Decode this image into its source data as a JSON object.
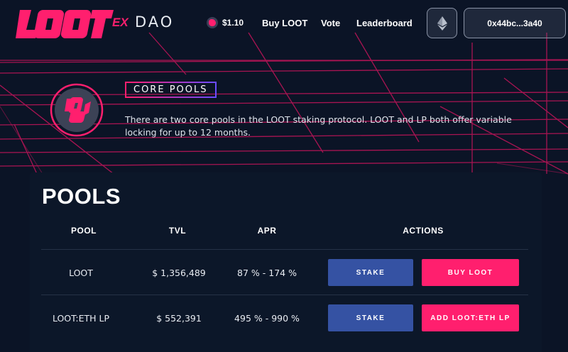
{
  "header": {
    "logo_loot": "LOOT",
    "logo_ex": "EX",
    "logo_dao": "DAO",
    "price": "$1.10",
    "nav": [
      "Buy LOOT",
      "Vote",
      "Leaderboard"
    ],
    "wallet_address": "0x44bc...3a40",
    "network_icon": "ethereum-icon"
  },
  "core": {
    "badge": "CORE POOLS",
    "description": "There are two core pools in the LOOT staking protocol. LOOT and LP both offer variable locking for up to 12 months."
  },
  "pools": {
    "title": "POOLS",
    "columns": [
      "POOL",
      "TVL",
      "APR",
      "ACTIONS"
    ],
    "rows": [
      {
        "pool": "LOOT",
        "tvl": "$ 1,356,489",
        "apr": "87 % - 174 %",
        "action1": "STAKE",
        "action2": "BUY LOOT"
      },
      {
        "pool": "LOOT:ETH LP",
        "tvl": "$ 552,391",
        "apr": "495 % - 990 %",
        "action1": "STAKE",
        "action2": "ADD LOOT:ETH LP"
      }
    ]
  },
  "colors": {
    "background": "#0b1426",
    "accent_pink": "#ff1f6e",
    "stake_blue": "#3552a3",
    "panel": "#0c1729"
  }
}
